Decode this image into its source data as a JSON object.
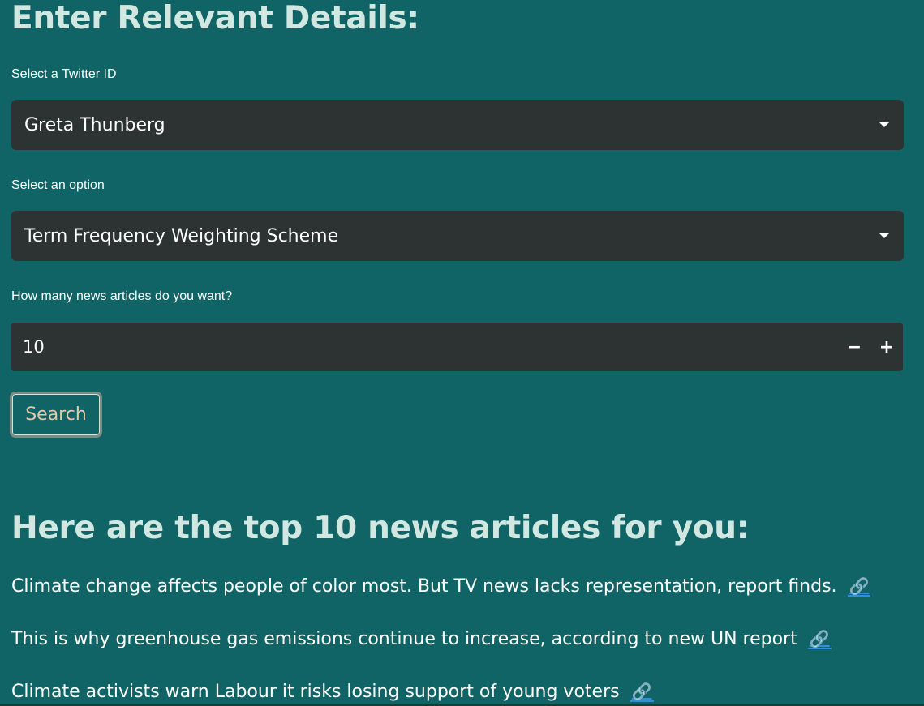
{
  "header": {
    "title": "Enter Relevant Details:"
  },
  "form": {
    "twitter_label": "Select a Twitter ID",
    "twitter_value": "Greta Thunberg",
    "option_label": "Select an option",
    "option_value": "Term Frequency Weighting Scheme",
    "count_label": "How many news articles do you want?",
    "count_value": "10",
    "decrement_label": "−",
    "increment_label": "+",
    "search_label": "Search"
  },
  "results": {
    "title": "Here are the top 10 news articles for you:",
    "link_icon": "🔗",
    "articles": [
      {
        "text": "Climate change affects people of color most. But TV news lacks representation, report finds."
      },
      {
        "text": "This is why greenhouse gas emissions continue to increase, according to new UN report"
      },
      {
        "text": "Climate activists warn Labour it risks losing support of young voters"
      }
    ]
  },
  "icons": {
    "dropdown": "chevron-down-icon",
    "link": "link-icon"
  }
}
